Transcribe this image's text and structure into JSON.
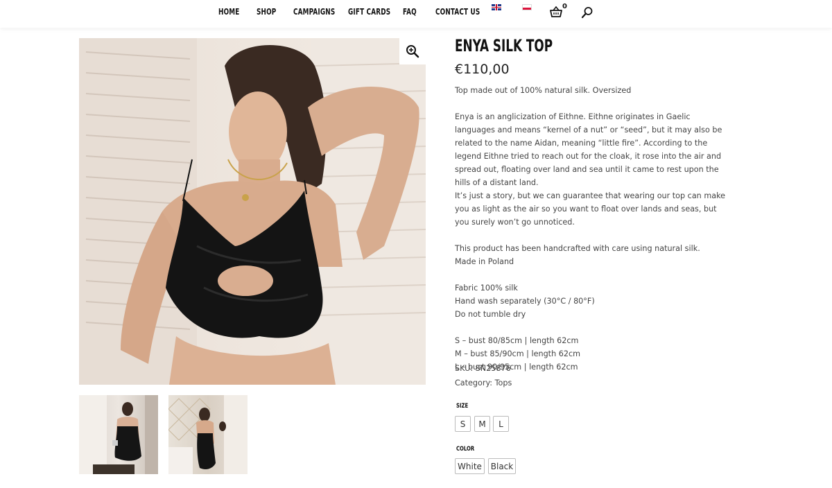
{
  "nav": {
    "items": [
      {
        "label": "HOME"
      },
      {
        "label": "SHOP"
      },
      {
        "label": "CAMPAIGNS"
      },
      {
        "label": "GIFT CARDS"
      },
      {
        "label": "FAQ"
      },
      {
        "label": "CONTACT US"
      }
    ],
    "cart_count": "0",
    "icons": [
      "uk-flag-icon",
      "poland-flag-icon",
      "basket-icon",
      "search-icon"
    ]
  },
  "gallery": {
    "zoom_icon": "magnify-plus-icon",
    "thumbnail_count": 2
  },
  "product": {
    "title": "ENYA SILK TOP",
    "price": "€110,00",
    "short_description": "Top made out of 100% natural silk. Oversized",
    "story": [
      "Enya is an anglicization of Eithne. Eithne originates in Gaelic languages and means “kernel of a nut” or “seed”, but it may also be related to the name Aidan, meaning “little fire”. According to the legend Eithne tried to reach out for the cloak, it rose into the air and spread out, floating over land and sea until it came to rest upon the hills of a distant land.",
      "It’s just a story, but we can guarantee that wearing our top can make you as light as the air so you want to float over lands and seas, but you surely won’t go unnoticed."
    ],
    "craft": [
      "This product has been handcrafted with care using natural silk.",
      "Made in Poland"
    ],
    "care": [
      "Fabric 100% silk",
      "Hand wash separately (30°C / 80°F)",
      "Do not tumble dry"
    ],
    "sizes_chart": [
      "S – bust 80/85cm | length 62cm",
      "M – bust 85/90cm | length 62cm",
      "L – bust 90/95cm | length 62cm"
    ],
    "sku": "SKU: SN25876",
    "category": "Category: Tops",
    "size_label": "SIZE",
    "sizes": [
      "S",
      "M",
      "L"
    ],
    "color_label": "COLOR",
    "colors": [
      "White",
      "Black"
    ]
  }
}
